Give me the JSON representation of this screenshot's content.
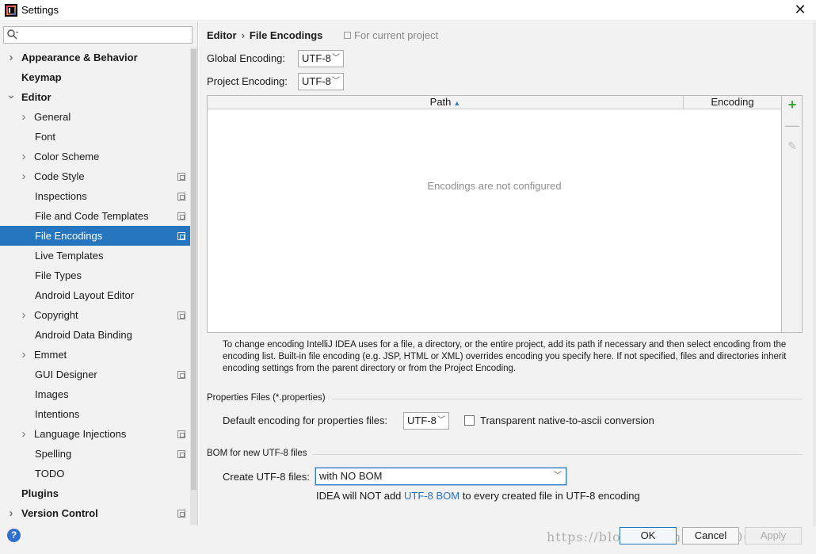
{
  "window": {
    "title": "Settings"
  },
  "search": {
    "placeholder": ""
  },
  "sidebar": {
    "items": [
      {
        "label": "Appearance & Behavior",
        "bold": true,
        "level": 0,
        "arrow": "collapsed",
        "project": false
      },
      {
        "label": "Keymap",
        "bold": true,
        "level": 0,
        "arrow": "none",
        "project": false
      },
      {
        "label": "Editor",
        "bold": true,
        "level": 0,
        "arrow": "expanded",
        "project": false
      },
      {
        "label": "General",
        "bold": false,
        "level": 1,
        "arrow": "collapsed",
        "project": false
      },
      {
        "label": "Font",
        "bold": false,
        "level": 1,
        "arrow": "none",
        "project": false
      },
      {
        "label": "Color Scheme",
        "bold": false,
        "level": 1,
        "arrow": "collapsed",
        "project": false
      },
      {
        "label": "Code Style",
        "bold": false,
        "level": 1,
        "arrow": "collapsed",
        "project": true
      },
      {
        "label": "Inspections",
        "bold": false,
        "level": 1,
        "arrow": "none",
        "project": true
      },
      {
        "label": "File and Code Templates",
        "bold": false,
        "level": 1,
        "arrow": "none",
        "project": true
      },
      {
        "label": "File Encodings",
        "bold": false,
        "level": 1,
        "arrow": "none",
        "project": true,
        "selected": true
      },
      {
        "label": "Live Templates",
        "bold": false,
        "level": 1,
        "arrow": "none",
        "project": false
      },
      {
        "label": "File Types",
        "bold": false,
        "level": 1,
        "arrow": "none",
        "project": false
      },
      {
        "label": "Android Layout Editor",
        "bold": false,
        "level": 1,
        "arrow": "none",
        "project": false
      },
      {
        "label": "Copyright",
        "bold": false,
        "level": 1,
        "arrow": "collapsed",
        "project": true
      },
      {
        "label": "Android Data Binding",
        "bold": false,
        "level": 1,
        "arrow": "none",
        "project": false
      },
      {
        "label": "Emmet",
        "bold": false,
        "level": 1,
        "arrow": "collapsed",
        "project": false
      },
      {
        "label": "GUI Designer",
        "bold": false,
        "level": 1,
        "arrow": "none",
        "project": true
      },
      {
        "label": "Images",
        "bold": false,
        "level": 1,
        "arrow": "none",
        "project": false
      },
      {
        "label": "Intentions",
        "bold": false,
        "level": 1,
        "arrow": "none",
        "project": false
      },
      {
        "label": "Language Injections",
        "bold": false,
        "level": 1,
        "arrow": "collapsed",
        "project": true
      },
      {
        "label": "Spelling",
        "bold": false,
        "level": 1,
        "arrow": "none",
        "project": true
      },
      {
        "label": "TODO",
        "bold": false,
        "level": 1,
        "arrow": "none",
        "project": false
      },
      {
        "label": "Plugins",
        "bold": true,
        "level": 0,
        "arrow": "none",
        "project": false
      },
      {
        "label": "Version Control",
        "bold": true,
        "level": 0,
        "arrow": "collapsed",
        "project": true
      }
    ]
  },
  "header": {
    "breadcrumb_parent": "Editor",
    "breadcrumb_sep": "›",
    "breadcrumb_current": "File Encodings",
    "scope": "For current project"
  },
  "encoding": {
    "global_label": "Global Encoding:",
    "global_value": "UTF-8",
    "project_label": "Project Encoding:",
    "project_value": "UTF-8"
  },
  "table": {
    "col_path": "Path",
    "col_encoding": "Encoding",
    "empty": "Encodings are not configured"
  },
  "help_text": "To change encoding IntelliJ IDEA uses for a file, a directory, or the entire project, add its path if necessary and then select encoding from the encoding list. Built-in file encoding (e.g. JSP, HTML or XML) overrides encoding you specify here. If not specified, files and directories inherit encoding settings from the parent directory or from the Project Encoding.",
  "properties": {
    "group_title": "Properties Files (*.properties)",
    "default_label": "Default encoding for properties files:",
    "default_value": "UTF-8",
    "transparent_label": "Transparent native-to-ascii conversion",
    "transparent_checked": false
  },
  "bom": {
    "group_title": "BOM for new UTF-8 files",
    "create_label": "Create UTF-8 files:",
    "create_value": "with NO BOM",
    "note_prefix": "IDEA will NOT add ",
    "note_link": "UTF-8 BOM",
    "note_suffix": " to every created file in UTF-8 encoding"
  },
  "buttons": {
    "ok": "OK",
    "cancel": "Cancel",
    "apply": "Apply",
    "help": "?"
  },
  "watermark": "https://blog.csdn.net/qq_40691285",
  "colors": {
    "selection": "#2675bf",
    "link": "#2a6fc4",
    "add": "#3ca33c"
  }
}
